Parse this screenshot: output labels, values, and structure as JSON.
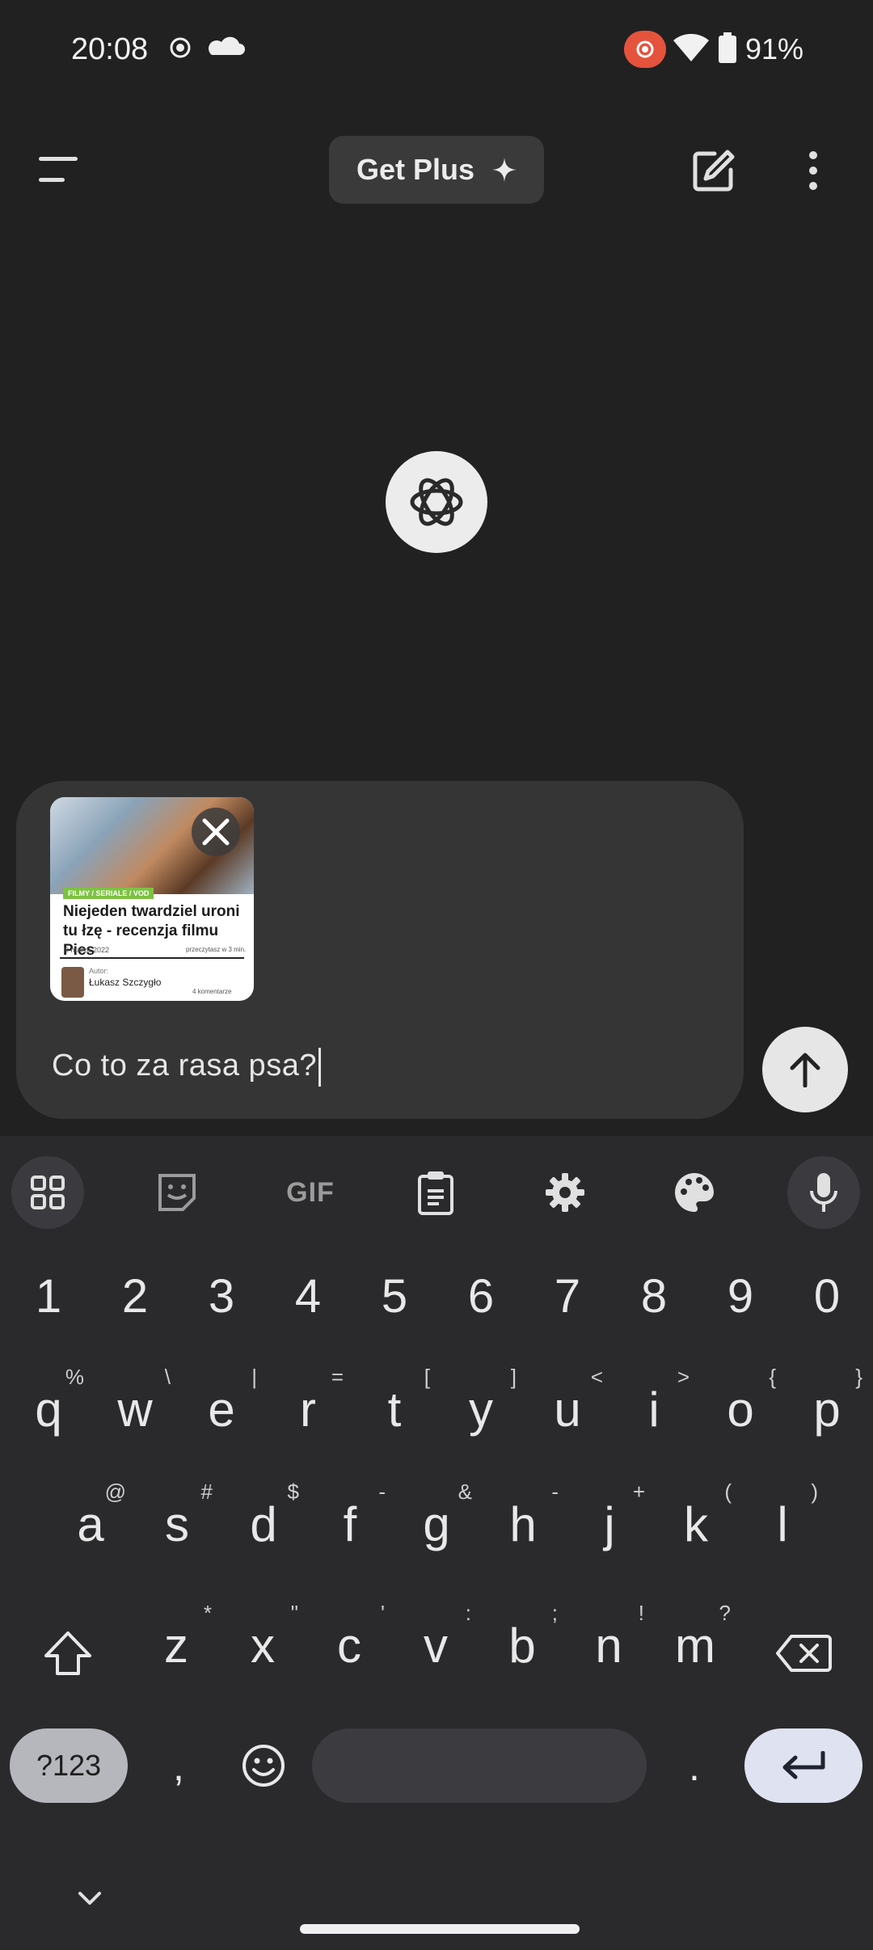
{
  "status_bar": {
    "time": "20:08",
    "battery": "91%",
    "icons": [
      "screenshot-icon",
      "cloud-icon",
      "screen-record-icon",
      "wifi-icon",
      "battery-icon"
    ],
    "record_color": "#e5533d"
  },
  "header": {
    "menu_icon": "menu-icon",
    "get_plus_label": "Get Plus",
    "new_chat_icon": "edit-icon",
    "more_icon": "more-vert-icon"
  },
  "logo": {
    "icon": "openai-logo-icon"
  },
  "attachment": {
    "tag": "FILMY / SERIALE / VOD",
    "headline": "Niejeden twardziel uroni tu łzę - recenzja filmu Pies",
    "date": "9 marca 2022",
    "read_time": "przeczytasz w 3 min.",
    "author_label": "Autor:",
    "author": "Łukasz Szczygło",
    "comments": "4 komentarze"
  },
  "composer": {
    "text": "Co to za rasa psa?",
    "send_icon": "arrow-up-icon"
  },
  "keyboard": {
    "toolbar": [
      "apps-grid-icon",
      "sticker-icon",
      "GIF",
      "clipboard-icon",
      "settings-gear-icon",
      "palette-icon",
      "mic-icon"
    ],
    "gif_label": "GIF",
    "numbers": [
      "1",
      "2",
      "3",
      "4",
      "5",
      "6",
      "7",
      "8",
      "9",
      "0"
    ],
    "row1": [
      {
        "k": "q",
        "h": "%"
      },
      {
        "k": "w",
        "h": "\\"
      },
      {
        "k": "e",
        "h": "|"
      },
      {
        "k": "r",
        "h": "="
      },
      {
        "k": "t",
        "h": "["
      },
      {
        "k": "y",
        "h": "]"
      },
      {
        "k": "u",
        "h": "<"
      },
      {
        "k": "i",
        "h": ">"
      },
      {
        "k": "o",
        "h": "{"
      },
      {
        "k": "p",
        "h": "}"
      }
    ],
    "row2": [
      {
        "k": "a",
        "h": "@"
      },
      {
        "k": "s",
        "h": "#"
      },
      {
        "k": "d",
        "h": "$"
      },
      {
        "k": "f",
        "h": "-"
      },
      {
        "k": "g",
        "h": "&"
      },
      {
        "k": "h",
        "h": "-"
      },
      {
        "k": "j",
        "h": "+"
      },
      {
        "k": "k",
        "h": "("
      },
      {
        "k": "l",
        "h": ")"
      }
    ],
    "row3": [
      {
        "k": "z",
        "h": "*"
      },
      {
        "k": "x",
        "h": "\""
      },
      {
        "k": "c",
        "h": "'"
      },
      {
        "k": "v",
        "h": ":"
      },
      {
        "k": "b",
        "h": ";"
      },
      {
        "k": "n",
        "h": "!"
      },
      {
        "k": "m",
        "h": "?"
      }
    ],
    "symbols_label": "?123",
    "comma": ",",
    "period": "."
  }
}
